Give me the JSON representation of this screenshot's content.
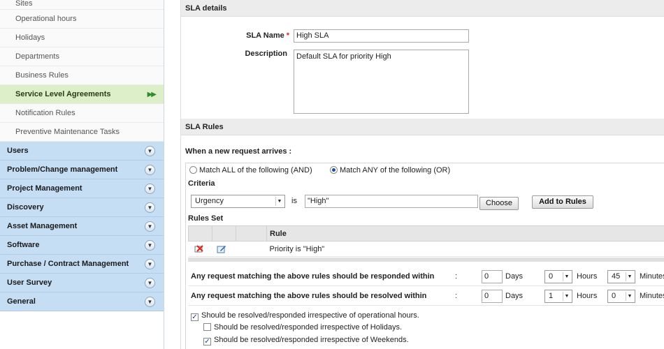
{
  "sidebar": {
    "sub_items": [
      {
        "label": "Sites"
      },
      {
        "label": "Operational hours"
      },
      {
        "label": "Holidays"
      },
      {
        "label": "Departments"
      },
      {
        "label": "Business Rules"
      },
      {
        "label": "Service Level Agreements",
        "active": true
      },
      {
        "label": "Notification Rules"
      },
      {
        "label": "Preventive Maintenance Tasks"
      }
    ],
    "categories": [
      {
        "label": "Users"
      },
      {
        "label": "Problem/Change management"
      },
      {
        "label": "Project Management"
      },
      {
        "label": "Discovery"
      },
      {
        "label": "Asset Management"
      },
      {
        "label": "Software"
      },
      {
        "label": "Purchase / Contract Management"
      },
      {
        "label": "User Survey"
      },
      {
        "label": "General"
      }
    ]
  },
  "sla_details": {
    "header": "SLA details",
    "name_label": "SLA Name",
    "name_value": "High SLA",
    "description_label": "Description",
    "description_value": "Default SLA for priority High"
  },
  "sla_rules": {
    "header": "SLA Rules",
    "trigger_label": "When a new request arrives :",
    "match_all_label": "Match ALL of the following (AND)",
    "match_any_label": "Match ANY of the following (OR)",
    "criteria_label": "Criteria",
    "criteria_field": "Urgency",
    "criteria_operator": "is",
    "criteria_value": "\"High\"",
    "choose_button": "Choose",
    "add_rules_button": "Add to Rules",
    "rules_set_label": "Rules Set",
    "rule_column": "Rule",
    "rules": [
      {
        "text": "Priority is \"High\""
      }
    ]
  },
  "timing": {
    "respond_label": "Any request matching the above rules should be responded within",
    "resolve_label": "Any request matching the above rules should be resolved within",
    "colon": ":",
    "respond": {
      "days": "0",
      "hours": "0",
      "minutes": "45"
    },
    "resolve": {
      "days": "0",
      "hours": "1",
      "minutes": "0"
    },
    "days_unit": "Days",
    "hours_unit": "Hours",
    "minutes_unit": "Minutes"
  },
  "options": {
    "operational_hours": "Should be resolved/responded irrespective of operational hours.",
    "holidays": "Should be resolved/responded irrespective of Holidays.",
    "weekends": "Should be resolved/responded irrespective of Weekends."
  }
}
